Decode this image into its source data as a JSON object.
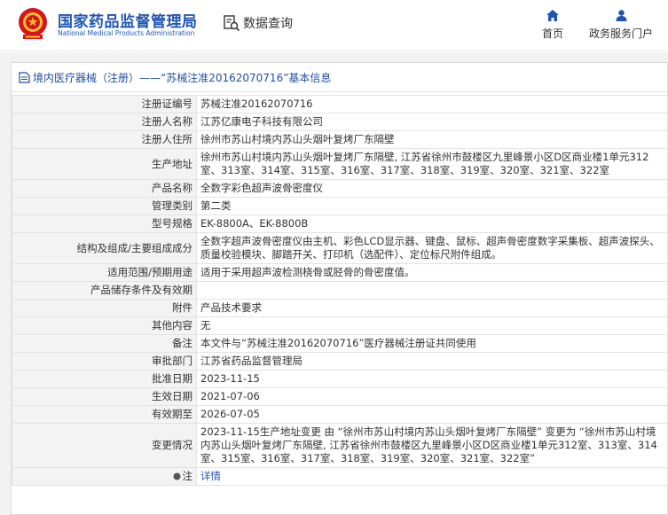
{
  "header": {
    "logo_cn": "国家药品监督管理局",
    "logo_en": "National Medical Products Administration",
    "data_query": "数据查询",
    "nav": {
      "home": "首页",
      "gov_portal": "政务服务门户"
    },
    "brand_color": "#1f56b4",
    "emblem_color": "#d7141a"
  },
  "breadcrumb": {
    "text": "境内医疗器械（注册）——“苏械注准20162070716”基本信息"
  },
  "record": {
    "rows": [
      {
        "label": "注册证编号",
        "value": "苏械注准20162070716"
      },
      {
        "label": "注册人名称",
        "value": "江苏亿康电子科技有限公司"
      },
      {
        "label": "注册人住所",
        "value": "徐州市苏山村境内苏山头烟叶复烤厂东隔壁"
      },
      {
        "label": "生产地址",
        "value": "徐州市苏山村境内苏山头烟叶复烤厂东隔壁, 江苏省徐州市鼓楼区九里峰景小区D区商业楼1单元312室、313室、314室、315室、316室、317室、318室、319室、320室、321室、322室"
      },
      {
        "label": "产品名称",
        "value": "全数字彩色超声波骨密度仪"
      },
      {
        "label": "管理类别",
        "value": "第二类"
      },
      {
        "label": "型号规格",
        "value": "EK-8800A、EK-8800B"
      },
      {
        "label": "结构及组成/主要组成成分",
        "value": "全数字超声波骨密度仪由主机、彩色LCD显示器、键盘、鼠标、超声骨密度数字采集板、超声波探头、质量校验模块、脚踏开关、打印机（选配件）、定位标尺附件组成。"
      },
      {
        "label": "适用范围/预期用途",
        "value": "适用于采用超声波检测桡骨或胫骨的骨密度值。"
      },
      {
        "label": "产品储存条件及有效期",
        "value": ""
      },
      {
        "label": "附件",
        "value": "产品技术要求"
      },
      {
        "label": "其他内容",
        "value": "无"
      },
      {
        "label": "备注",
        "value": "本文件与“苏械注准20162070716”医疗器械注册证共同使用"
      },
      {
        "label": "审批部门",
        "value": "江苏省药品监督管理局"
      },
      {
        "label": "批准日期",
        "value": "2023-11-15"
      },
      {
        "label": "生效日期",
        "value": "2021-07-06"
      },
      {
        "label": "有效期至",
        "value": "2026-07-05"
      },
      {
        "label": "变更情况",
        "value": "2023-11-15生产地址变更 由 “徐州市苏山村境内苏山头烟叶复烤厂东隔壁” 变更为 “徐州市苏山村境内苏山头烟叶复烤厂东隔壁, 江苏省徐州市鼓楼区九里峰景小区D区商业楼1单元312室、313室、314室、315室、316室、317室、318室、319室、320室、321室、322室”"
      }
    ],
    "note": {
      "label": "注",
      "link": "详情"
    }
  }
}
